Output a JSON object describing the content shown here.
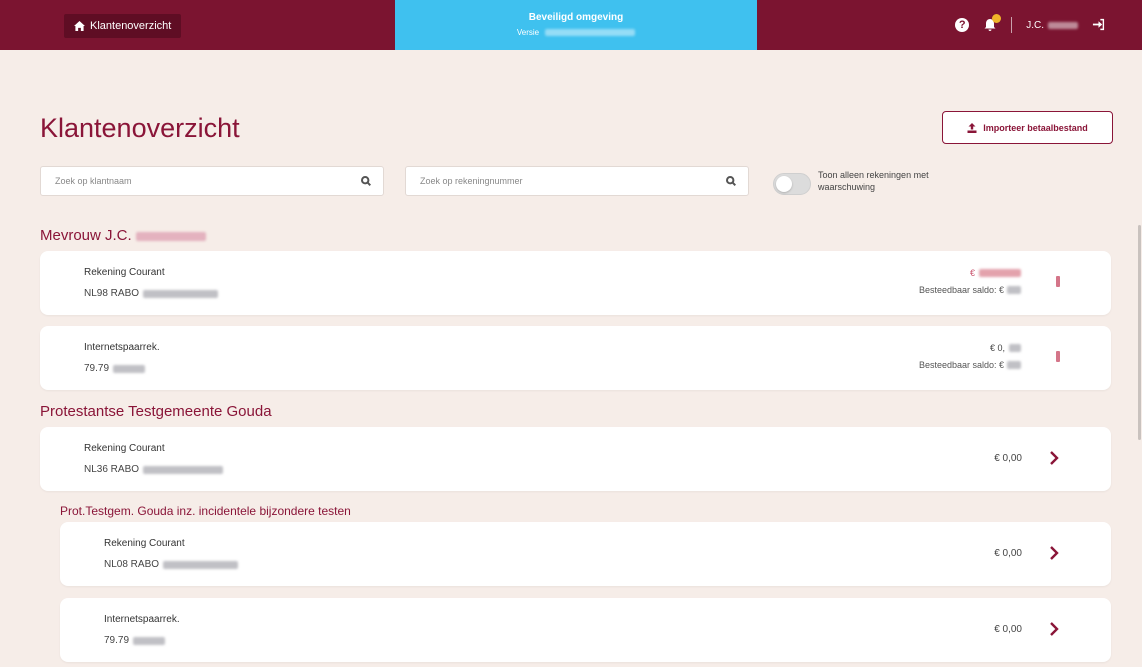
{
  "topbar": {
    "home_label": "Klantenoverzicht",
    "environment_title": "Beveiligd omgeving",
    "environment_sub_label": "Versie",
    "user_initials": "J.C."
  },
  "page": {
    "title": "Klantenoverzicht",
    "import_label": "Importeer betaalbestand"
  },
  "filters": {
    "customer_placeholder": "Zoek op klantnaam",
    "account_placeholder": "Zoek op rekeningnummer",
    "toggle_label": "Toon alleen rekeningen met waarschuwing"
  },
  "groups": [
    {
      "name": "Mevrouw J.C.",
      "accounts": [
        {
          "name": "Rekening Courant",
          "number": "NL98 RABO",
          "amount": "€",
          "available_label": "Besteedbaar saldo: €",
          "warning": true
        },
        {
          "name": "Internetspaarrek.",
          "number": "79.79",
          "amount": "€ 0,",
          "available_label": "Besteedbaar saldo: €",
          "warning": true
        }
      ]
    },
    {
      "name": "Protestantse Testgemeente Gouda",
      "accounts": [
        {
          "name": "Rekening Courant",
          "number": "NL36 RABO",
          "amount": "€ 0,00",
          "warning": false
        }
      ]
    },
    {
      "name": "Prot.Testgem. Gouda inz. incidentele bijzondere testen",
      "accounts": [
        {
          "name": "Rekening Courant",
          "number": "NL08 RABO",
          "amount": "€ 0,00",
          "warning": false
        },
        {
          "name": "Internetspaarrek.",
          "number": "79.79",
          "amount": "€ 0,00",
          "warning": false
        }
      ]
    }
  ],
  "colors": {
    "brand": "#7b1430",
    "accent": "#8a1538",
    "environment": "#3fc1ef",
    "background": "#f6ede8"
  },
  "icons": {
    "home": "home-icon",
    "help": "help-icon",
    "bell": "bell-icon",
    "logout": "logout-icon",
    "upload": "upload-icon",
    "search": "search-icon",
    "chevron": "chevron-right-icon"
  }
}
